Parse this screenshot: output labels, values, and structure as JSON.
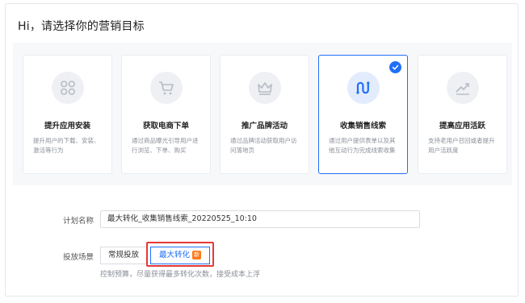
{
  "page": {
    "title": "Hi，请选择你的营销目标"
  },
  "goals": [
    {
      "name": "提升应用安装",
      "desc": "提升用户的下载、安装、激活等行为",
      "icon": "app-grid-icon",
      "selected": false
    },
    {
      "name": "获取电商下单",
      "desc": "通过商品曝光引导用户进行浏览、下单、购买",
      "icon": "shopping-cart-icon",
      "selected": false
    },
    {
      "name": "推广品牌活动",
      "desc": "通过品牌活动获取用户访问落地页",
      "icon": "crown-icon",
      "selected": false
    },
    {
      "name": "收集销售线索",
      "desc": "通过用户提供表单以及其他互动行为完成线索收集",
      "icon": "leads-path-icon",
      "selected": true
    },
    {
      "name": "提高应用活跃",
      "desc": "支持老用户召回或者提升用户活跃度",
      "icon": "trend-chart-icon",
      "selected": false
    }
  ],
  "form": {
    "plan_label": "计划名称",
    "plan_value": "最大转化_收集销售线索_20220525_10:10",
    "scene_label": "投放场景",
    "scene_options": [
      {
        "label": "常规投放",
        "active": false
      },
      {
        "label": "最大转化",
        "active": true,
        "badge": "新"
      }
    ],
    "scene_hint": "控制预算，尽量获得最多转化次数，接受成本上浮"
  },
  "colors": {
    "accent": "#1f6ff7",
    "badge": "#ff7a1a",
    "highlight": "#e53935"
  }
}
